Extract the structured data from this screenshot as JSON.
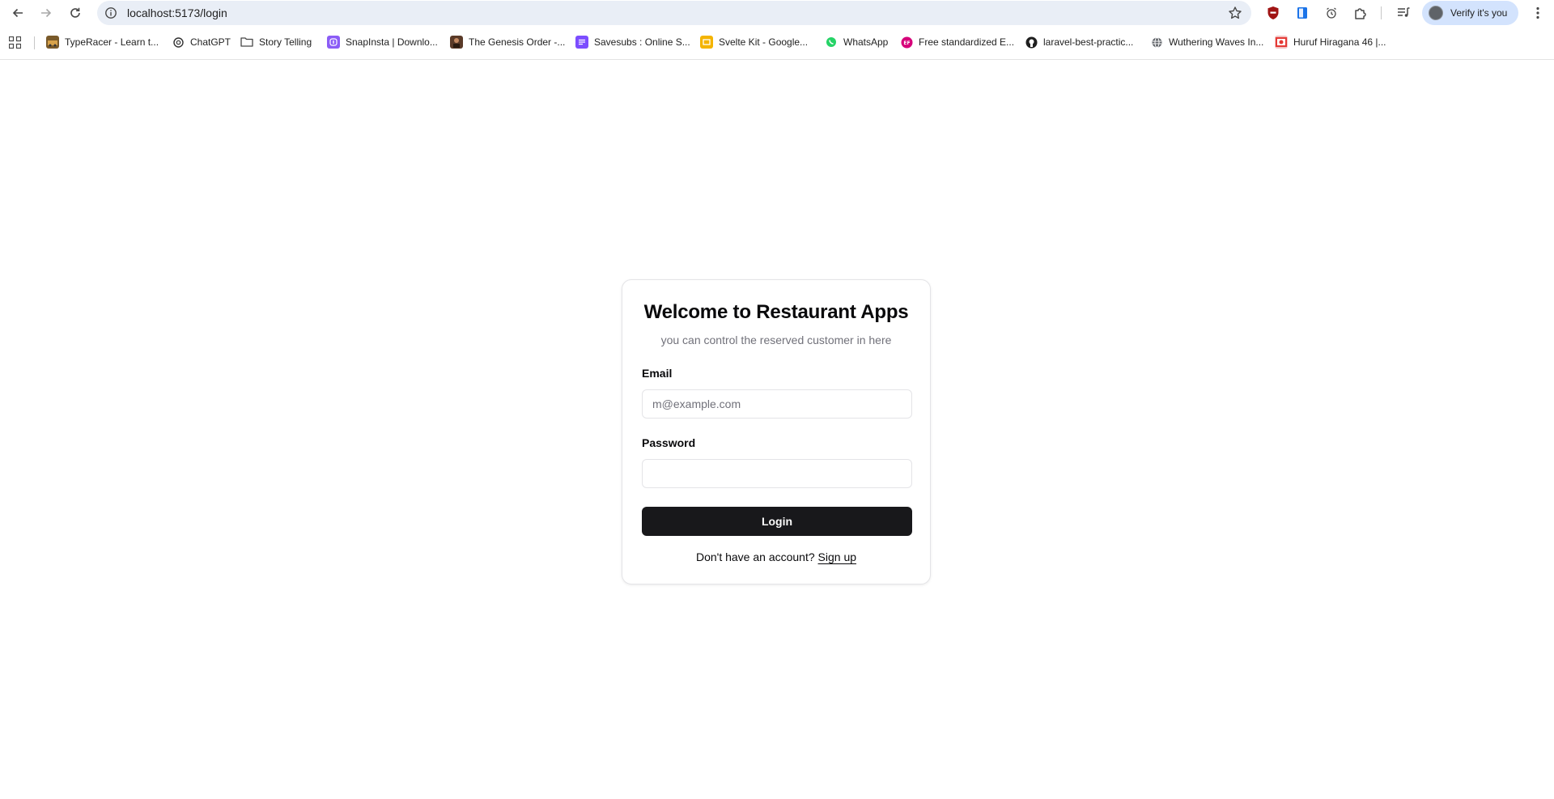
{
  "browser": {
    "url": "localhost:5173/login",
    "profile_label": "Verify it's you",
    "bookmarks": [
      {
        "label": "TypeRacer - Learn t...",
        "icon": "typeracer-icon"
      },
      {
        "label": "ChatGPT",
        "icon": "chatgpt-icon"
      },
      {
        "label": "Story Telling",
        "icon": "folder-icon"
      },
      {
        "label": "SnapInsta | Downlo...",
        "icon": "snapinsta-icon"
      },
      {
        "label": "The Genesis Order -...",
        "icon": "genesis-order-icon"
      },
      {
        "label": "Savesubs : Online S...",
        "icon": "savesubs-icon"
      },
      {
        "label": "Svelte Kit - Google...",
        "icon": "google-slides-icon"
      },
      {
        "label": "WhatsApp",
        "icon": "whatsapp-icon"
      },
      {
        "label": "Free standardized E...",
        "icon": "ef-icon"
      },
      {
        "label": "laravel-best-practic...",
        "icon": "github-icon"
      },
      {
        "label": "Wuthering Waves In...",
        "icon": "globe-icon"
      },
      {
        "label": "Huruf Hiragana 46 |...",
        "icon": "japan-flag-icon"
      }
    ]
  },
  "login": {
    "title": "Welcome to Restaurant Apps",
    "subtitle": "you can control the reserved customer in here",
    "email_label": "Email",
    "email_placeholder": "m@example.com",
    "email_value": "",
    "password_label": "Password",
    "password_value": "",
    "submit_label": "Login",
    "signup_prompt": "Don't have an account?",
    "signup_link": "Sign up"
  },
  "colors": {
    "primary_button": "#18181b",
    "muted_text": "#71717a",
    "border": "#e4e4e7",
    "omnibox_bg": "#e9eef6",
    "profile_chip_bg": "#d3e3fd"
  }
}
